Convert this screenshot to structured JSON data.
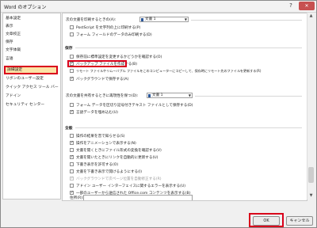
{
  "window": {
    "title": "Word のオプション",
    "help": "?",
    "close": "✕"
  },
  "sidebar": {
    "items": [
      {
        "label": "基本設定"
      },
      {
        "label": "表示"
      },
      {
        "label": "文章校正"
      },
      {
        "label": "保存"
      },
      {
        "label": "文字体裁"
      },
      {
        "label": "言語"
      },
      {
        "label": "詳細設定",
        "active": true
      },
      {
        "label": "リボンのユーザー設定"
      },
      {
        "label": "クイック アクセス ツール バー"
      },
      {
        "label": "アドイン"
      },
      {
        "label": "セキュリティ センター"
      }
    ]
  },
  "content": {
    "print_header": {
      "label": "次の文書を印刷するときの(A):",
      "dropdown": "文書 1"
    },
    "print_options": [
      {
        "label": "PostScript を文字列の上に印刷する(P)",
        "checked": false
      },
      {
        "label": "フォーム フィールドのデータのみ印刷する(D)",
        "checked": false
      }
    ],
    "save_section": "保存",
    "save_options": [
      {
        "label": "保存前に標準設定を変更するかどうかを確認する(O)",
        "checked": false
      },
      {
        "label": "バックアップ ファイルを作成する(B)",
        "checked": true
      },
      {
        "label": "リモート ファイルやリムーバブル ファイルをこのコンピューターにコピーして、保存時にリモート先のファイルを更新する(R)",
        "checked": false
      },
      {
        "label": "バックグラウンドで保存する(A)",
        "checked": true
      }
    ],
    "share_header": {
      "label": "次の文書を共有するときに再現性を保つ(D):",
      "dropdown": "文書 1"
    },
    "share_options": [
      {
        "label": "フォーム データを区切り記号付きテキスト ファイルとして保存する(D)",
        "checked": false
      },
      {
        "label": "言語データを埋め込む(U)",
        "checked": true
      }
    ],
    "general_section": "全般",
    "general_options": [
      {
        "label": "操作の結果を音で知らせる(S)",
        "checked": false,
        "disabled": false
      },
      {
        "label": "操作をアニメーションで表示する(N)",
        "checked": true,
        "disabled": false
      },
      {
        "label": "文書を開くときにファイル形式の変換を確認する(V)",
        "checked": false,
        "disabled": false
      },
      {
        "label": "文書を開いたときにリンクを自動的に更新する(U)",
        "checked": true,
        "disabled": false
      },
      {
        "label": "下書き表示を許可する(O)",
        "checked": false,
        "disabled": false
      },
      {
        "label": "文書を下書き表示で開けるようにする(I)",
        "checked": false,
        "disabled": false
      },
      {
        "label": "バックグラウンドで次ページ位置を自動修正する(R)",
        "checked": true,
        "disabled": true
      },
      {
        "label": "アドイン ユーザー インターフェイスに関するエラーを表示する(U)",
        "checked": false,
        "disabled": false
      },
      {
        "label": "一部のユーザーから送信された Office.com コンテンツを表示する(B)",
        "checked": true,
        "disabled": false
      }
    ],
    "address_label": "住所(R):"
  },
  "footer": {
    "ok": "OK",
    "cancel": "キャンセル"
  }
}
